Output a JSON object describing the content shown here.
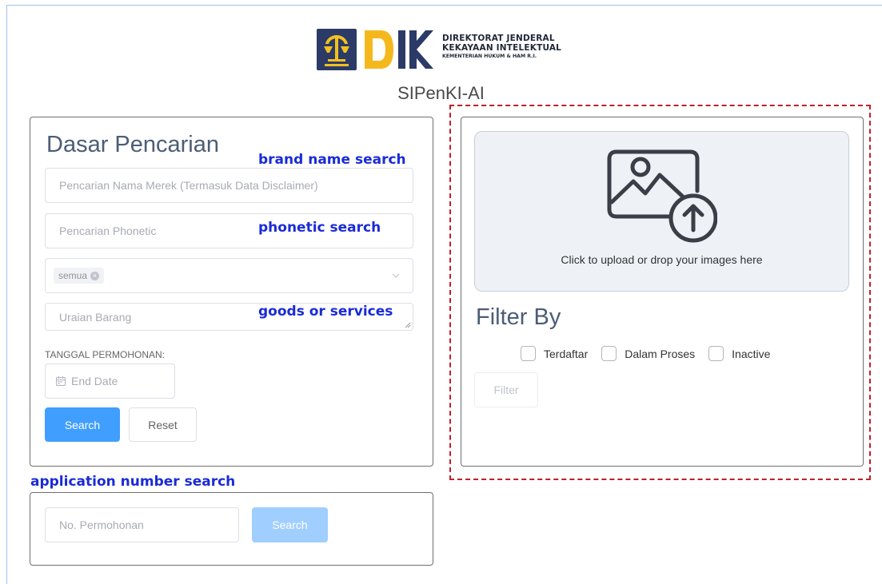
{
  "header": {
    "logo": {
      "line1": "DIREKTORAT JENDERAL",
      "line2": "KEKAYAAN INTELEKTUAL",
      "line3": "KEMENTERIAN HUKUM & HAM R.I."
    },
    "app_title": "SIPenKI-AI"
  },
  "dasar": {
    "heading": "Dasar Pencarian",
    "brand_placeholder": "Pencarian Nama Merek (Termasuk Data Disclaimer)",
    "phonetic_placeholder": "Pencarian Phonetic",
    "select_tag": "semua",
    "goods_placeholder": "Uraian Barang",
    "date_label": "TANGGAL PERMOHONAN:",
    "date_placeholder": "End Date",
    "search_label": "Search",
    "reset_label": "Reset"
  },
  "image_search": {
    "upload_text": "Click to upload or drop your images here",
    "filter_heading": "Filter By",
    "checkboxes": [
      {
        "label": "Terdaftar",
        "checked": false
      },
      {
        "label": "Dalam Proses",
        "checked": false
      },
      {
        "label": "Inactive",
        "checked": false
      }
    ],
    "filter_button": "Filter"
  },
  "application_search": {
    "placeholder": "No. Permohonan",
    "search_label": "Search"
  },
  "annotations": {
    "brand": "brand name search",
    "phonetic": "phonetic search",
    "goods": "goods or services",
    "application": "application number search"
  },
  "colors": {
    "primary": "#409eff",
    "primary_disabled": "#a0cfff",
    "annotation": "#1a2bd8",
    "highlight_box": "#c0202a",
    "heading": "#4c5d75"
  },
  "icons": [
    "calendar-icon",
    "chevron-down-icon",
    "image-upload-icon",
    "close-icon"
  ]
}
